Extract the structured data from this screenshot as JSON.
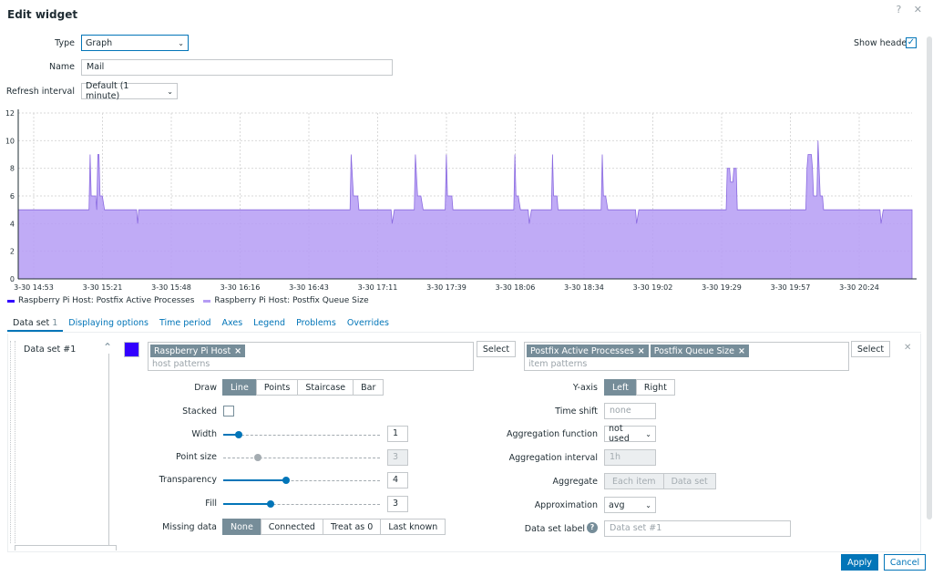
{
  "dialog": {
    "title": "Edit widget",
    "help_icon": "?",
    "close_icon": "✕",
    "apply_label": "Apply",
    "cancel_label": "Cancel"
  },
  "form": {
    "type_label": "Type",
    "type_value": "Graph",
    "name_label": "Name",
    "name_value": "Mail",
    "refresh_label": "Refresh interval",
    "refresh_value": "Default (1 minute)",
    "show_header_label": "Show header",
    "show_header_checked": true
  },
  "chart_data": {
    "type": "area",
    "x_labels": [
      "3-30 14:53",
      "3-30 15:21",
      "3-30 15:48",
      "3-30 16:16",
      "3-30 16:43",
      "3-30 17:11",
      "3-30 17:39",
      "3-30 18:06",
      "3-30 18:34",
      "3-30 19:02",
      "3-30 19:29",
      "3-30 19:57",
      "3-30 20:24"
    ],
    "ylim": [
      0,
      12
    ],
    "y_ticks": [
      0,
      2,
      4,
      6,
      8,
      10,
      12
    ],
    "grid": true,
    "series": [
      {
        "name": "Raspberry Pi Host: Postfix Active Processes",
        "color": "#3300ff",
        "values": []
      },
      {
        "name": "Raspberry Pi Host: Postfix Queue Size",
        "color": "#b59cf4",
        "points": [
          [
            0,
            5
          ],
          [
            64,
            5
          ],
          [
            65,
            9
          ],
          [
            66,
            6
          ],
          [
            70,
            6
          ],
          [
            71,
            5
          ],
          [
            72,
            9
          ],
          [
            73,
            9
          ],
          [
            74,
            6
          ],
          [
            76,
            6
          ],
          [
            78,
            5
          ],
          [
            107,
            5
          ],
          [
            108,
            4
          ],
          [
            109,
            5
          ],
          [
            300,
            5
          ],
          [
            301,
            9
          ],
          [
            303,
            6
          ],
          [
            307,
            6
          ],
          [
            308,
            5
          ],
          [
            337,
            5
          ],
          [
            338,
            4
          ],
          [
            340,
            5
          ],
          [
            358,
            5
          ],
          [
            359,
            9
          ],
          [
            361,
            6
          ],
          [
            364,
            6
          ],
          [
            366,
            5
          ],
          [
            386,
            5
          ],
          [
            387,
            9
          ],
          [
            388,
            6
          ],
          [
            392,
            6
          ],
          [
            393,
            5
          ],
          [
            448,
            5
          ],
          [
            449,
            9
          ],
          [
            450,
            6
          ],
          [
            452,
            6
          ],
          [
            454,
            5
          ],
          [
            461,
            5
          ],
          [
            462,
            4
          ],
          [
            464,
            5
          ],
          [
            482,
            5
          ],
          [
            483,
            9
          ],
          [
            484,
            6
          ],
          [
            487,
            6
          ],
          [
            488,
            5
          ],
          [
            527,
            5
          ],
          [
            528,
            9
          ],
          [
            529,
            6
          ],
          [
            531,
            6
          ],
          [
            533,
            5
          ],
          [
            558,
            5
          ],
          [
            559,
            4
          ],
          [
            561,
            5
          ],
          [
            640,
            5
          ],
          [
            641,
            8
          ],
          [
            643,
            8
          ],
          [
            644,
            7
          ],
          [
            646,
            7
          ],
          [
            647,
            8
          ],
          [
            649,
            8
          ],
          [
            650,
            5
          ],
          [
            712,
            5
          ],
          [
            713,
            8
          ],
          [
            714,
            9
          ],
          [
            717,
            9
          ],
          [
            718,
            8
          ],
          [
            719,
            6
          ],
          [
            722,
            6
          ],
          [
            723,
            10
          ],
          [
            725,
            6
          ],
          [
            727,
            6
          ],
          [
            728,
            5
          ],
          [
            779,
            5
          ],
          [
            780,
            4
          ],
          [
            782,
            5
          ],
          [
            808,
            5
          ]
        ]
      }
    ],
    "legend_position": "bottom-left"
  },
  "tabs": [
    {
      "label": "Data set",
      "count": "1",
      "active": true
    },
    {
      "label": "Displaying options"
    },
    {
      "label": "Time period"
    },
    {
      "label": "Axes"
    },
    {
      "label": "Legend"
    },
    {
      "label": "Problems"
    },
    {
      "label": "Overrides"
    }
  ],
  "dataset": {
    "name": "Data set #1",
    "color": "#3300ff",
    "host_tag": "Raspberry Pi Host",
    "host_placeholder": "host patterns",
    "item_tags": [
      "Postfix Active Processes",
      "Postfix Queue Size"
    ],
    "item_placeholder": "item patterns",
    "select_label": "Select",
    "draw_label": "Draw",
    "draw_options": [
      "Line",
      "Points",
      "Staircase",
      "Bar"
    ],
    "stacked_label": "Stacked",
    "width_label": "Width",
    "width_value": "1",
    "width_level": 0.1,
    "point_size_label": "Point size",
    "point_size_value": "3",
    "point_size_level": 0.22,
    "transparency_label": "Transparency",
    "transparency_value": "4",
    "transparency_level": 0.4,
    "fill_label": "Fill",
    "fill_value": "3",
    "fill_level": 0.3,
    "missing_label": "Missing data",
    "missing_options": [
      "None",
      "Connected",
      "Treat as 0",
      "Last known"
    ],
    "yaxis_label": "Y-axis",
    "yaxis_options": [
      "Left",
      "Right"
    ],
    "timeshift_label": "Time shift",
    "timeshift_placeholder": "none",
    "aggfunc_label": "Aggregation function",
    "aggfunc_value": "not used",
    "agginterval_label": "Aggregation interval",
    "agginterval_placeholder": "1h",
    "aggregate_label": "Aggregate",
    "aggregate_options": [
      "Each item",
      "Data set"
    ],
    "approx_label": "Approximation",
    "approx_value": "avg",
    "dslabel_label": "Data set label",
    "dslabel_placeholder": "Data set #1",
    "help_icon": "?"
  }
}
